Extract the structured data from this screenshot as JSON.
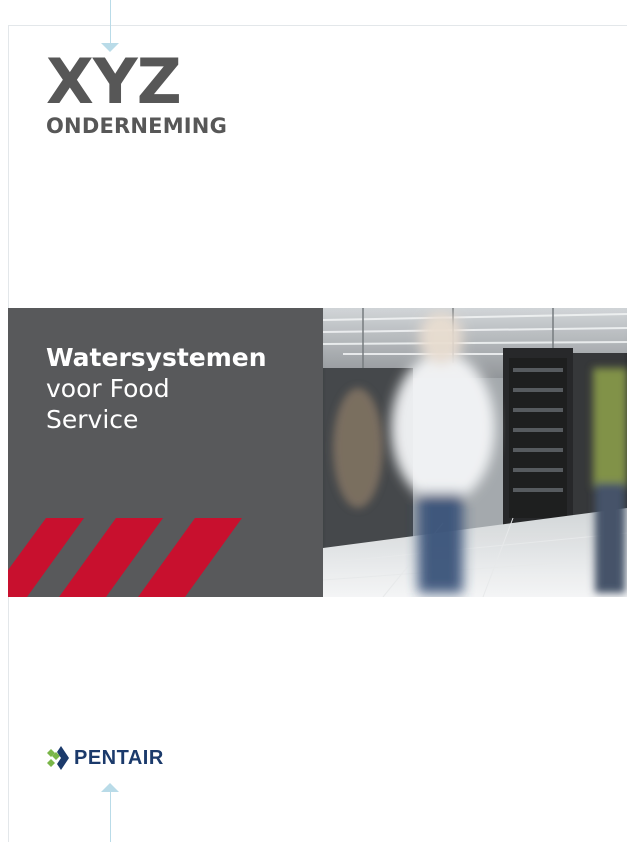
{
  "brand": {
    "name": "XYZ",
    "subtitle": "ONDERNEMING"
  },
  "cover": {
    "title_bold": "Watersystemen",
    "title_line2": "voor Food",
    "title_line3": "Service"
  },
  "logo": {
    "text": "PENTAIR"
  },
  "colors": {
    "band_gray": "#58595b",
    "accent_red": "#c8102e",
    "logo_navy": "#1b3a6b",
    "logo_green": "#7ab648",
    "guide_blue": "#b9dbe8"
  }
}
